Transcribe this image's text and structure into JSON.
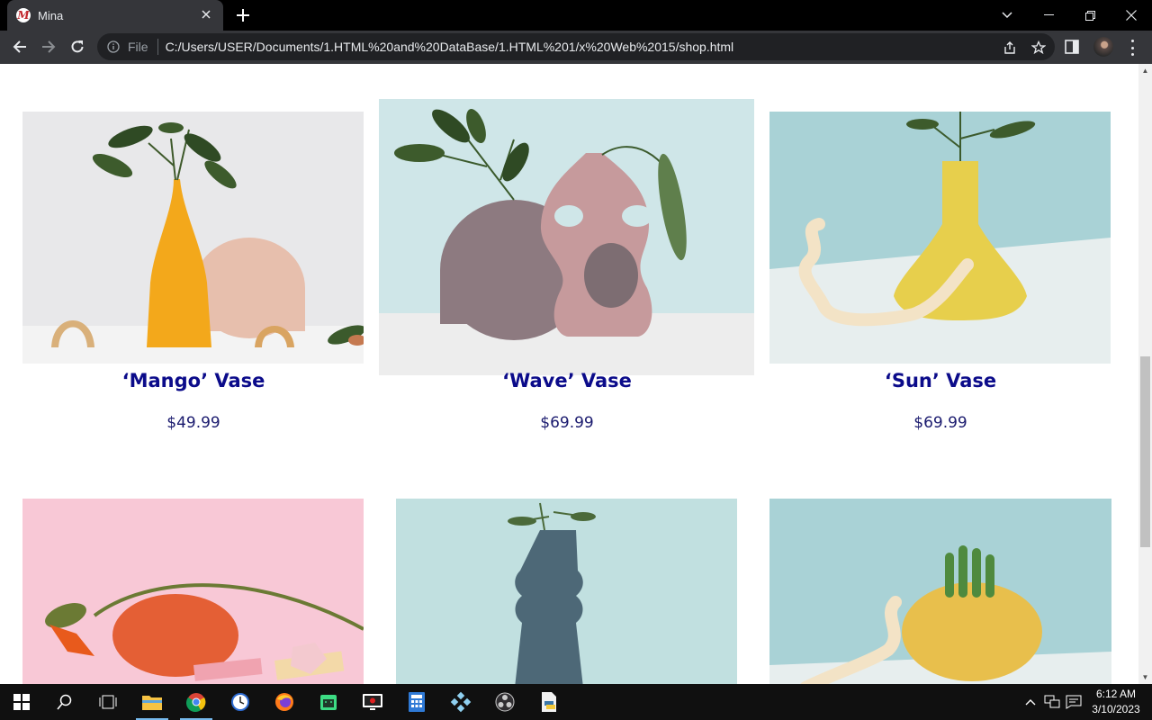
{
  "browser": {
    "tab_title": "Mina",
    "favicon_letter": "M",
    "omnibox_scheme": "File",
    "url": "C:/Users/USER/Documents/1.HTML%20and%20DataBase/1.HTML%201/x%20Web%2015/shop.html"
  },
  "products": [
    {
      "name": "‘Mango’ Vase",
      "price": "$49.99"
    },
    {
      "name": "‘Wave’ Vase",
      "price": "$69.99"
    },
    {
      "name": "‘Sun’ Vase",
      "price": "$69.99"
    }
  ],
  "taskbar": {
    "time": "6:12 AM",
    "date": "3/10/2023"
  },
  "colors": {
    "product_name": "#0b0b8a",
    "product_price": "#1a1a6e",
    "chrome_tab": "#35363a",
    "omnibox": "#202124"
  }
}
